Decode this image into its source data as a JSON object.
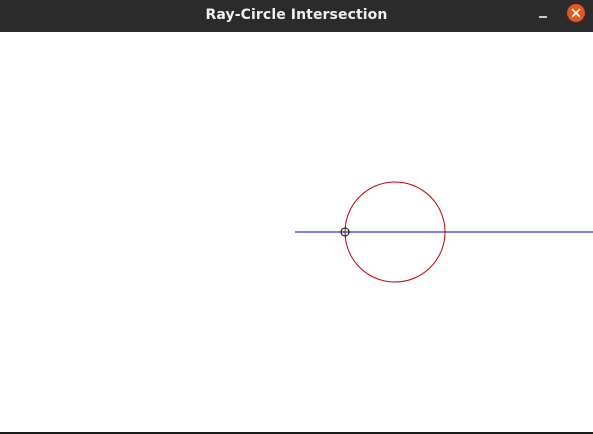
{
  "window": {
    "title": "Ray-Circle Intersection"
  },
  "controls": {
    "minimize_icon": "minimize-icon",
    "close_icon": "close-icon",
    "close_color": "#e95420"
  },
  "scene": {
    "ray_color": "#0000c8",
    "circle_color": "#c80000",
    "marker_color": "#000000"
  }
}
